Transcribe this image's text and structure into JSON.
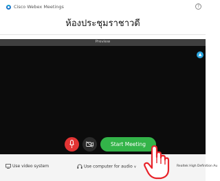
{
  "window": {
    "title": "Cisco Webex Meetings",
    "help": "?"
  },
  "meeting": {
    "title": "ห้องประชุมราชาวดี"
  },
  "preview": {
    "label": "Preview"
  },
  "controls": {
    "start_meeting": "Start Meeting"
  },
  "bottom": {
    "video_system": "Use video system",
    "audio": "Use computer for audio",
    "audio_chevron": "∨",
    "device": "Realtek High Definition Au"
  },
  "colors": {
    "accent": "#33b449",
    "mute": "#e23434",
    "brand": "#1a73c9",
    "cursor": "#e8232a"
  }
}
